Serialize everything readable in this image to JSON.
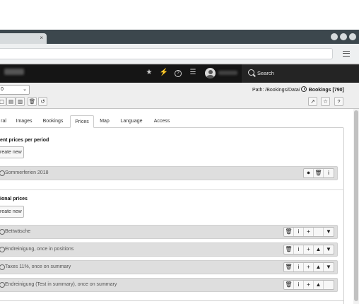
{
  "browser": {
    "tab_close": "×"
  },
  "topbar": {
    "icons": [
      "star-icon",
      "bolt-icon",
      "help-icon",
      "list-icon",
      "user-avatar"
    ],
    "star": "★",
    "bolt": "⚡",
    "help": "?",
    "list": "☰",
    "search_label": "Search"
  },
  "docheader": {
    "select_value": "0",
    "path_prefix": "Path: /Bookings/Data/",
    "path_title": "Bookings [790]",
    "toolbar_left": [
      "close",
      "save",
      "save-new",
      "save-close",
      "delete",
      "history"
    ],
    "toolbar_right": [
      "open-external",
      "bookmark",
      "help"
    ]
  },
  "tabs": [
    {
      "label": "ral",
      "active": false
    },
    {
      "label": "Images",
      "active": false
    },
    {
      "label": "Bookings",
      "active": false
    },
    {
      "label": "Prices",
      "active": true
    },
    {
      "label": "Map",
      "active": false
    },
    {
      "label": "Language",
      "active": false
    },
    {
      "label": "Access",
      "active": false
    }
  ],
  "section1": {
    "heading": "ent prices per period",
    "create_label": "reate new",
    "rows": [
      {
        "label": "Sommerferien 2018"
      }
    ]
  },
  "section2": {
    "heading": "ional prices",
    "create_label": "reate new",
    "rows": [
      {
        "label": "Bettwäsche"
      },
      {
        "label": "Endreinigung, once in positions"
      },
      {
        "label": "Taxes 11%, once on summary"
      },
      {
        "label": "Endreinigung (Test in summary), once on summary"
      }
    ]
  },
  "button_glyphs": {
    "trash": "🗑",
    "info": "i",
    "plus": "+",
    "up": "▲",
    "down": "▼",
    "toggle": "⏻"
  }
}
